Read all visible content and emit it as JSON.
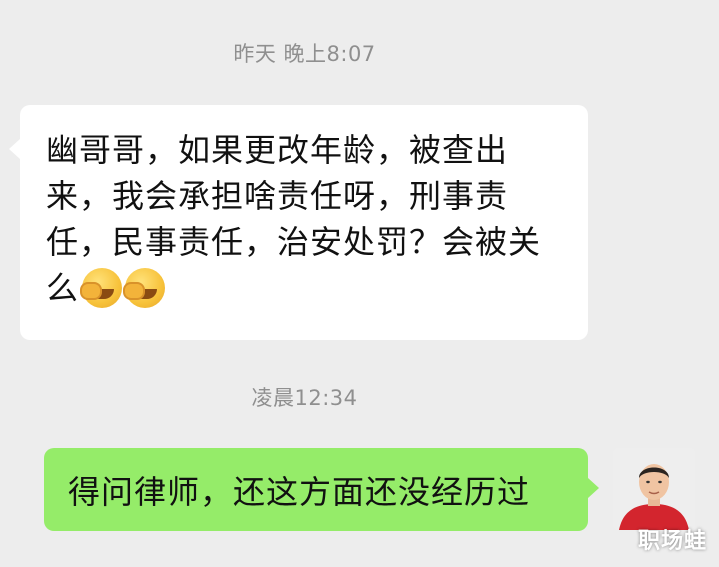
{
  "chat": {
    "timestamp_1": "昨天 晚上8:07",
    "incoming_message": "幽哥哥，如果更改年龄，被查出来，我会承担啥责任呀，刑事责任，民事责任，治安处罚？会被关么",
    "incoming_emojis": [
      "face-palm-emoji",
      "face-palm-emoji"
    ],
    "timestamp_2": "凌晨12:34",
    "outgoing_message": "得问律师，还这方面还没经历过"
  },
  "watermark": "职场蛙",
  "colors": {
    "background": "#ededed",
    "incoming_bubble": "#ffffff",
    "outgoing_bubble": "#95ec69",
    "timestamp": "#8f8f8f"
  }
}
